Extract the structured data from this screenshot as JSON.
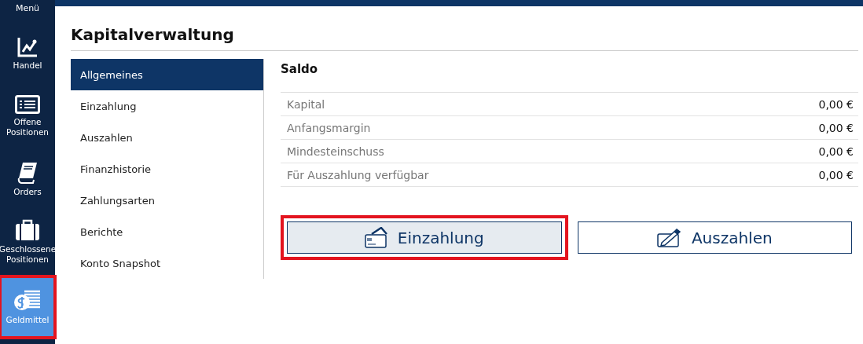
{
  "sidebar": {
    "menu_label": "Menü",
    "items": [
      {
        "kind": "chart",
        "label": "Handel",
        "selected": false,
        "highlighted": false
      },
      {
        "kind": "list",
        "label": "Offene Positionen",
        "selected": false,
        "highlighted": false
      },
      {
        "kind": "book",
        "label": "Orders",
        "selected": false,
        "highlighted": false
      },
      {
        "kind": "briefcase",
        "label": "Geschlossene Positionen",
        "selected": false,
        "highlighted": false
      },
      {
        "kind": "money",
        "label": "Geldmittel",
        "selected": true,
        "highlighted": true
      }
    ]
  },
  "page": {
    "title": "Kapitalverwaltung"
  },
  "nav": [
    {
      "label": "Allgemeines",
      "selected": true
    },
    {
      "label": "Einzahlung",
      "selected": false
    },
    {
      "label": "Auszahlen",
      "selected": false
    },
    {
      "label": "Finanzhistorie",
      "selected": false
    },
    {
      "label": "Zahlungsarten",
      "selected": false
    },
    {
      "label": "Berichte",
      "selected": false
    },
    {
      "label": "Konto Snapshot",
      "selected": false
    }
  ],
  "balance": {
    "title": "Saldo",
    "rows": [
      {
        "label": "Kapital",
        "value": "0,00 €"
      },
      {
        "label": "Anfangsmargin",
        "value": "0,00 €"
      },
      {
        "label": "Mindesteinschuss",
        "value": "0,00 €"
      },
      {
        "label": "Für Auszahlung verfügbar",
        "value": "0,00 €"
      }
    ]
  },
  "buttons": [
    {
      "kind": "card",
      "label": "Einzahlung",
      "highlighted": true
    },
    {
      "kind": "cheque",
      "label": "Auszahlen",
      "highlighted": false
    }
  ]
}
